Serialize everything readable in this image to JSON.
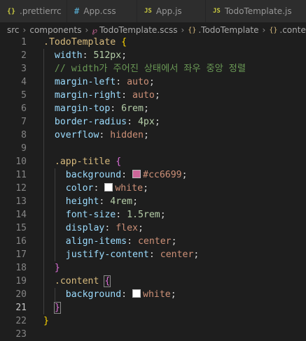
{
  "tabs": [
    {
      "icon": "{}",
      "label": ".prettierrc"
    },
    {
      "icon": "#",
      "label": "App.css"
    },
    {
      "icon": "JS",
      "label": "App.js"
    },
    {
      "icon": "JS",
      "label": "TodoTemplate.js"
    }
  ],
  "breadcrumb": {
    "items": [
      "src",
      "components",
      "TodoTemplate.scss",
      ".TodoTemplate",
      ".content"
    ]
  },
  "colors": {
    "app_title_background": "#cc6699",
    "white": "#ffffff",
    "editor_background": "#1e1e1e"
  },
  "editor": {
    "current_line": 21,
    "lines": [
      {
        "n": "1",
        "tokens": [
          {
            "t": ".TodoTemplate",
            "c": "sel"
          },
          {
            "t": " ",
            "c": "punc"
          },
          {
            "t": "{",
            "c": "brace"
          }
        ]
      },
      {
        "n": "2",
        "tokens": [
          {
            "t": "  width",
            "c": "prop"
          },
          {
            "t": ": ",
            "c": "punc"
          },
          {
            "t": "512px",
            "c": "num"
          },
          {
            "t": ";",
            "c": "punc"
          }
        ]
      },
      {
        "n": "3",
        "tokens": [
          {
            "t": "  // width가 주어진 상태에서 좌우 중앙 정렬",
            "c": "cmt"
          }
        ]
      },
      {
        "n": "4",
        "tokens": [
          {
            "t": "  margin-left",
            "c": "prop"
          },
          {
            "t": ": ",
            "c": "punc"
          },
          {
            "t": "auto",
            "c": "val"
          },
          {
            "t": ";",
            "c": "punc"
          }
        ]
      },
      {
        "n": "5",
        "tokens": [
          {
            "t": "  margin-right",
            "c": "prop"
          },
          {
            "t": ": ",
            "c": "punc"
          },
          {
            "t": "auto",
            "c": "val"
          },
          {
            "t": ";",
            "c": "punc"
          }
        ]
      },
      {
        "n": "6",
        "tokens": [
          {
            "t": "  margin-top",
            "c": "prop"
          },
          {
            "t": ": ",
            "c": "punc"
          },
          {
            "t": "6rem",
            "c": "num"
          },
          {
            "t": ";",
            "c": "punc"
          }
        ]
      },
      {
        "n": "7",
        "tokens": [
          {
            "t": "  border-radius",
            "c": "prop"
          },
          {
            "t": ": ",
            "c": "punc"
          },
          {
            "t": "4px",
            "c": "num"
          },
          {
            "t": ";",
            "c": "punc"
          }
        ]
      },
      {
        "n": "8",
        "tokens": [
          {
            "t": "  overflow",
            "c": "prop"
          },
          {
            "t": ": ",
            "c": "punc"
          },
          {
            "t": "hidden",
            "c": "val"
          },
          {
            "t": ";",
            "c": "punc"
          }
        ]
      },
      {
        "n": "9",
        "tokens": []
      },
      {
        "n": "10",
        "tokens": [
          {
            "t": "  .app-title",
            "c": "sel"
          },
          {
            "t": " ",
            "c": "punc"
          },
          {
            "t": "{",
            "c": "brace2"
          }
        ]
      },
      {
        "n": "11",
        "tokens": [
          {
            "t": "    background",
            "c": "prop"
          },
          {
            "t": ": ",
            "c": "punc"
          },
          {
            "swatch": "#cc6699"
          },
          {
            "t": "#cc6699",
            "c": "val"
          },
          {
            "t": ";",
            "c": "punc"
          }
        ]
      },
      {
        "n": "12",
        "tokens": [
          {
            "t": "    color",
            "c": "prop"
          },
          {
            "t": ": ",
            "c": "punc"
          },
          {
            "swatch": "#ffffff"
          },
          {
            "t": "white",
            "c": "val"
          },
          {
            "t": ";",
            "c": "punc"
          }
        ]
      },
      {
        "n": "13",
        "tokens": [
          {
            "t": "    height",
            "c": "prop"
          },
          {
            "t": ": ",
            "c": "punc"
          },
          {
            "t": "4rem",
            "c": "num"
          },
          {
            "t": ";",
            "c": "punc"
          }
        ]
      },
      {
        "n": "14",
        "tokens": [
          {
            "t": "    font-size",
            "c": "prop"
          },
          {
            "t": ": ",
            "c": "punc"
          },
          {
            "t": "1.5rem",
            "c": "num"
          },
          {
            "t": ";",
            "c": "punc"
          }
        ]
      },
      {
        "n": "15",
        "tokens": [
          {
            "t": "    display",
            "c": "prop"
          },
          {
            "t": ": ",
            "c": "punc"
          },
          {
            "t": "flex",
            "c": "val"
          },
          {
            "t": ";",
            "c": "punc"
          }
        ]
      },
      {
        "n": "16",
        "tokens": [
          {
            "t": "    align-items",
            "c": "prop"
          },
          {
            "t": ": ",
            "c": "punc"
          },
          {
            "t": "center",
            "c": "val"
          },
          {
            "t": ";",
            "c": "punc"
          }
        ]
      },
      {
        "n": "17",
        "tokens": [
          {
            "t": "    justify-content",
            "c": "prop"
          },
          {
            "t": ": ",
            "c": "punc"
          },
          {
            "t": "center",
            "c": "val"
          },
          {
            "t": ";",
            "c": "punc"
          }
        ]
      },
      {
        "n": "18",
        "tokens": [
          {
            "t": "  ",
            "c": "punc"
          },
          {
            "t": "}",
            "c": "brace2"
          }
        ]
      },
      {
        "n": "19",
        "tokens": [
          {
            "t": "  .content",
            "c": "sel"
          },
          {
            "t": " ",
            "c": "punc"
          },
          {
            "t": "{",
            "c": "brace2",
            "box": true
          }
        ]
      },
      {
        "n": "20",
        "tokens": [
          {
            "t": "    background",
            "c": "prop"
          },
          {
            "t": ": ",
            "c": "punc"
          },
          {
            "swatch": "#ffffff"
          },
          {
            "t": "white",
            "c": "val"
          },
          {
            "t": ";",
            "c": "punc"
          }
        ]
      },
      {
        "n": "21",
        "tokens": [
          {
            "t": "  ",
            "c": "punc"
          },
          {
            "t": "}",
            "c": "brace2",
            "box": true
          }
        ]
      },
      {
        "n": "22",
        "tokens": [
          {
            "t": "}",
            "c": "brace"
          }
        ]
      },
      {
        "n": "23",
        "tokens": []
      }
    ]
  }
}
